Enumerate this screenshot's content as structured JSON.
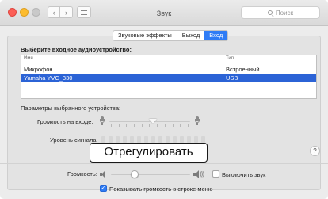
{
  "window": {
    "title": "Звук"
  },
  "search": {
    "placeholder": "Поиск"
  },
  "tabs": [
    {
      "label": "Звуковые эффекты",
      "active": false
    },
    {
      "label": "Выход",
      "active": false
    },
    {
      "label": "Вход",
      "active": true
    }
  ],
  "input_section": {
    "heading": "Выберите входное аудиоустройство:",
    "columns": [
      "Имя",
      "Тип"
    ],
    "rows": [
      {
        "name": "Микрофон",
        "type": "Встроенный",
        "selected": false
      },
      {
        "name": "Yamaha YVC_330",
        "type": "USB",
        "selected": true
      }
    ]
  },
  "device_settings": {
    "heading": "Параметры выбранного устройства:",
    "input_volume_label": "Громкость на входе:",
    "input_volume_level": 0.5,
    "signal_level_label": "Уровень сигнала:"
  },
  "tooltip": {
    "text": "Отрегулировать"
  },
  "help": {
    "label": "?"
  },
  "output": {
    "volume_label": "Громкость:",
    "volume_level": 0.3,
    "mute_label": "Выключить звук",
    "mute_checked": false,
    "show_in_menu_label": "Показывать громкость в строке меню",
    "show_in_menu_checked": true
  },
  "colors": {
    "accent": "#2f7cf5",
    "selection": "#2b63d6"
  }
}
